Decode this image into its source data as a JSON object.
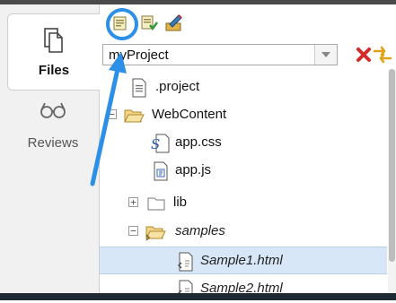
{
  "tabs": [
    {
      "label": "Files",
      "icon": "files-icon",
      "active": true
    },
    {
      "label": "Reviews",
      "icon": "glasses-icon",
      "active": false
    }
  ],
  "toolbar": {
    "buttons": [
      {
        "icon": "new-project-icon",
        "highlighted": true
      },
      {
        "icon": "import-project-icon"
      },
      {
        "icon": "edit-project-icon"
      }
    ]
  },
  "project_select": {
    "value": "myProject"
  },
  "tree": [
    {
      "label": ".project",
      "type": "file",
      "level": 1
    },
    {
      "label": "WebContent",
      "type": "folder-open",
      "level": 0,
      "toggle": "−"
    },
    {
      "label": "app.css",
      "type": "css-file",
      "level": 2
    },
    {
      "label": "app.js",
      "type": "js-file",
      "level": 2
    },
    {
      "label": "lib",
      "type": "folder",
      "level": 1,
      "toggle": "+"
    },
    {
      "label": "samples",
      "type": "folder-open-linked",
      "level": 1,
      "toggle": "−",
      "italic": true
    },
    {
      "label": "Sample1.html",
      "type": "html-file",
      "level": 3,
      "italic": true,
      "selected": true
    },
    {
      "label": "Sample2.html",
      "type": "html-file",
      "level": 3,
      "italic": true
    }
  ],
  "colors": {
    "highlight": "#2e8fe6",
    "selection": "#d7e7f7"
  }
}
